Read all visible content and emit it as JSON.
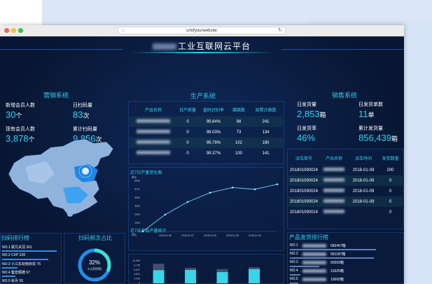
{
  "browser": {
    "url": "urlofyourwebsite",
    "colors": {
      "close": "#ff5f57",
      "minimize": "#febc2e",
      "maximize": "#28c840"
    }
  },
  "dashboard": {
    "title_suffix": "工业互联网云平台",
    "marketing": {
      "title": "营销系统",
      "new_members_label": "新增会员人数",
      "new_members_value": "30",
      "new_members_unit": "个",
      "daily_scans_label": "日扫码量",
      "daily_scans_value": "83",
      "daily_scans_unit": "次",
      "existing_members_label": "现有会员人数",
      "existing_members_value": "3,878",
      "existing_members_unit": "个",
      "total_scans_label": "累计扫码量",
      "total_scans_value": "9,856",
      "total_scans_unit": "次"
    },
    "production": {
      "title": "生产系统",
      "columns": [
        "产品名称",
        "日产质量",
        "盖码识别率",
        "蹋箱数",
        "周累计箱数"
      ],
      "rows": [
        [
          "0",
          "99.64%",
          "98",
          "241"
        ],
        [
          "0",
          "99.03%",
          "73",
          "134"
        ],
        [
          "0",
          "99.78%",
          "102",
          "190"
        ],
        [
          "0",
          "99.37%",
          "100",
          "141"
        ]
      ]
    },
    "sales": {
      "title": "销售系统",
      "daily_shipment_label": "日发货量",
      "daily_shipment_value": "2,853",
      "daily_shipment_unit": "箱",
      "daily_orders_label": "日发货单数",
      "daily_orders_value": "11",
      "daily_orders_unit": "单",
      "daily_rate_label": "日发货率",
      "daily_rate_value": "46%",
      "total_shipment_label": "累计发货量",
      "total_shipment_value": "856,439",
      "total_shipment_unit": "箱"
    },
    "dispatch": {
      "columns": [
        "派车单号",
        "产品名称",
        "派车时间",
        "发货数量"
      ],
      "rows": [
        [
          "201801090024",
          "2018-01-09",
          "200"
        ],
        [
          "201801090024",
          "2018-01-09",
          "0"
        ],
        [
          "201801090024",
          "2018-01-09",
          "0"
        ],
        [
          "201801090024",
          "2018-01-09",
          "0"
        ],
        [
          "201801090024",
          "",
          "0"
        ]
      ]
    },
    "scan_rank": {
      "title": "扫码排行榜",
      "items": [
        "NO.1 颍凡关羽 261",
        "NO.2 CXP 228",
        "NO.3 小江东初南商贸 76",
        "NO.4 集宏顺德 67",
        "NO.5 秋月 55"
      ]
    },
    "scan_freq": {
      "title": "扫码频次占比",
      "percent": "32%",
      "caption": "2-4次扫码",
      "fraction": 0.32
    },
    "trend_chart": {
      "title": "近7日产量变化图",
      "y_unit": "单位",
      "y_ticks": [
        "6000",
        "5212",
        "4500",
        "3500",
        "2000",
        "1000",
        "0"
      ],
      "x_ticks": [
        "2018-01-08",
        "2018-01-07",
        "2018-01-06",
        "2018-01-05",
        "2018-01-04"
      ]
    },
    "product_chart": {
      "title": "近7日产品产量统计",
      "y_unit": "单位",
      "y_ticks": [
        "12,993",
        "9,745",
        "6,497",
        "4,872",
        "2,439",
        "0"
      ]
    },
    "shipping_rank": {
      "title": "产品发货排行榜",
      "items": [
        "NO.1",
        "NO.2",
        "NO.3",
        "NO.4",
        "NO.5"
      ],
      "values": [
        "583457箱",
        "581187箱",
        "50093箱",
        "13325箱",
        "10000箱"
      ]
    }
  },
  "chart_data": [
    {
      "type": "line",
      "title": "近7日产量变化图",
      "ylabel": "单位",
      "x": [
        "",
        "2018-01-08",
        "2018-01-07",
        "2018-01-06",
        "2018-01-05",
        "2018-01-04",
        ""
      ],
      "values": [
        0,
        2000,
        3500,
        4600,
        5212,
        5000,
        5600
      ],
      "ylim": [
        0,
        6000
      ]
    },
    {
      "type": "bar",
      "title": "近7日产品产量统计",
      "ylabel": "单位",
      "categories": [
        "",
        "",
        "",
        ""
      ],
      "series": [
        {
          "values": [
            7300,
            5800,
            5300,
            6000
          ]
        },
        {
          "values": [
            4900,
            5000,
            4200,
            5300
          ]
        }
      ],
      "ylim": [
        0,
        12993
      ]
    }
  ]
}
